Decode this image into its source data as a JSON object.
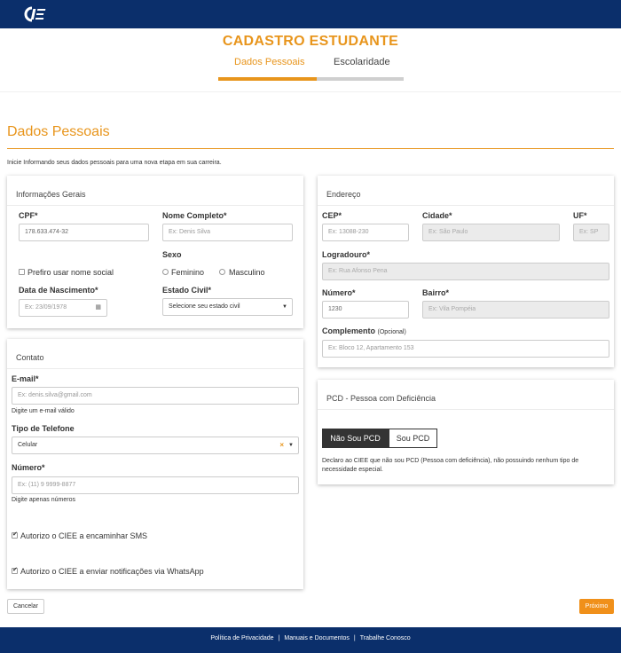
{
  "brand": {
    "logo_text": "CIEE",
    "primary_color": "#0b2f6b",
    "accent_color": "#e8951c"
  },
  "page": {
    "title": "CADASTRO ESTUDANTE"
  },
  "steps": [
    {
      "label": "Dados Pessoais",
      "active": true
    },
    {
      "label": "Escolaridade",
      "active": false
    }
  ],
  "progress": {
    "completed_fraction": 0.53
  },
  "section": {
    "title": "Dados Pessoais",
    "intro": "Inicie Informando seus dados pessoais para uma nova etapa em sua carreira."
  },
  "info_gerais": {
    "title": "Informações Gerais",
    "cpf": {
      "label": "CPF*",
      "value": "178.633.474-32"
    },
    "nome": {
      "label": "Nome Completo*",
      "placeholder": "Ex: Denis Silva"
    },
    "nome_social": {
      "label": "Prefiro usar nome social",
      "checked": false
    },
    "sexo": {
      "label": "Sexo",
      "options": [
        "Feminino",
        "Masculino"
      ]
    },
    "nascimento": {
      "label": "Data de Nascimento*",
      "placeholder": "Ex: 23/09/1978",
      "icon": "calendar-icon"
    },
    "estado_civil": {
      "label": "Estado Civil*",
      "value": "Selecione seu estado civil"
    }
  },
  "contato": {
    "title": "Contato",
    "email": {
      "label": "E-mail*",
      "placeholder": "Ex: denis.silva@gmail.com",
      "help": "Digite um e-mail válido"
    },
    "tipo_telefone": {
      "label": "Tipo de Telefone",
      "value": "Celular",
      "clear": "×"
    },
    "numero": {
      "label": "Número*",
      "placeholder": "Ex: (11) 9 9999-8877",
      "help": "Digite apenas números"
    },
    "sms": {
      "label": "Autorizo o CIEE a encaminhar SMS",
      "checked": true
    },
    "whatsapp": {
      "label": "Autorizo o CIEE a enviar notificações via WhatsApp",
      "checked": true
    }
  },
  "endereco": {
    "title": "Endereço",
    "cep": {
      "label": "CEP*",
      "placeholder": "Ex: 13088-230"
    },
    "cidade": {
      "label": "Cidade*",
      "placeholder": "Ex: São Paulo"
    },
    "uf": {
      "label": "UF*",
      "placeholder": "Ex: SP"
    },
    "logradouro": {
      "label": "Logradouro*",
      "placeholder": "Ex: Rua Afonso Pena"
    },
    "numero": {
      "label": "Número*",
      "value": "1230"
    },
    "bairro": {
      "label": "Bairro*",
      "placeholder": "Ex: Vila Pompéia"
    },
    "complemento": {
      "label": "Complemento",
      "optional": "(Opcional)",
      "placeholder": "Ex: Bloco 12, Apartamento 153"
    }
  },
  "pcd": {
    "title": "PCD - Pessoa com Deficiência",
    "btn_no": "Não Sou PCD",
    "btn_yes": "Sou PCD",
    "selected": "Não Sou PCD",
    "text": "Declaro ao CIEE que não sou PCD (Pessoa com deficiência), não possuindo nenhum tipo de necessidade especial."
  },
  "actions": {
    "cancel": "Cancelar",
    "next": "Próximo"
  },
  "footer": {
    "links": [
      "Política de Privacidade",
      "Manuais e Documentos",
      "Trabalhe Conosco"
    ],
    "separator": "|"
  }
}
